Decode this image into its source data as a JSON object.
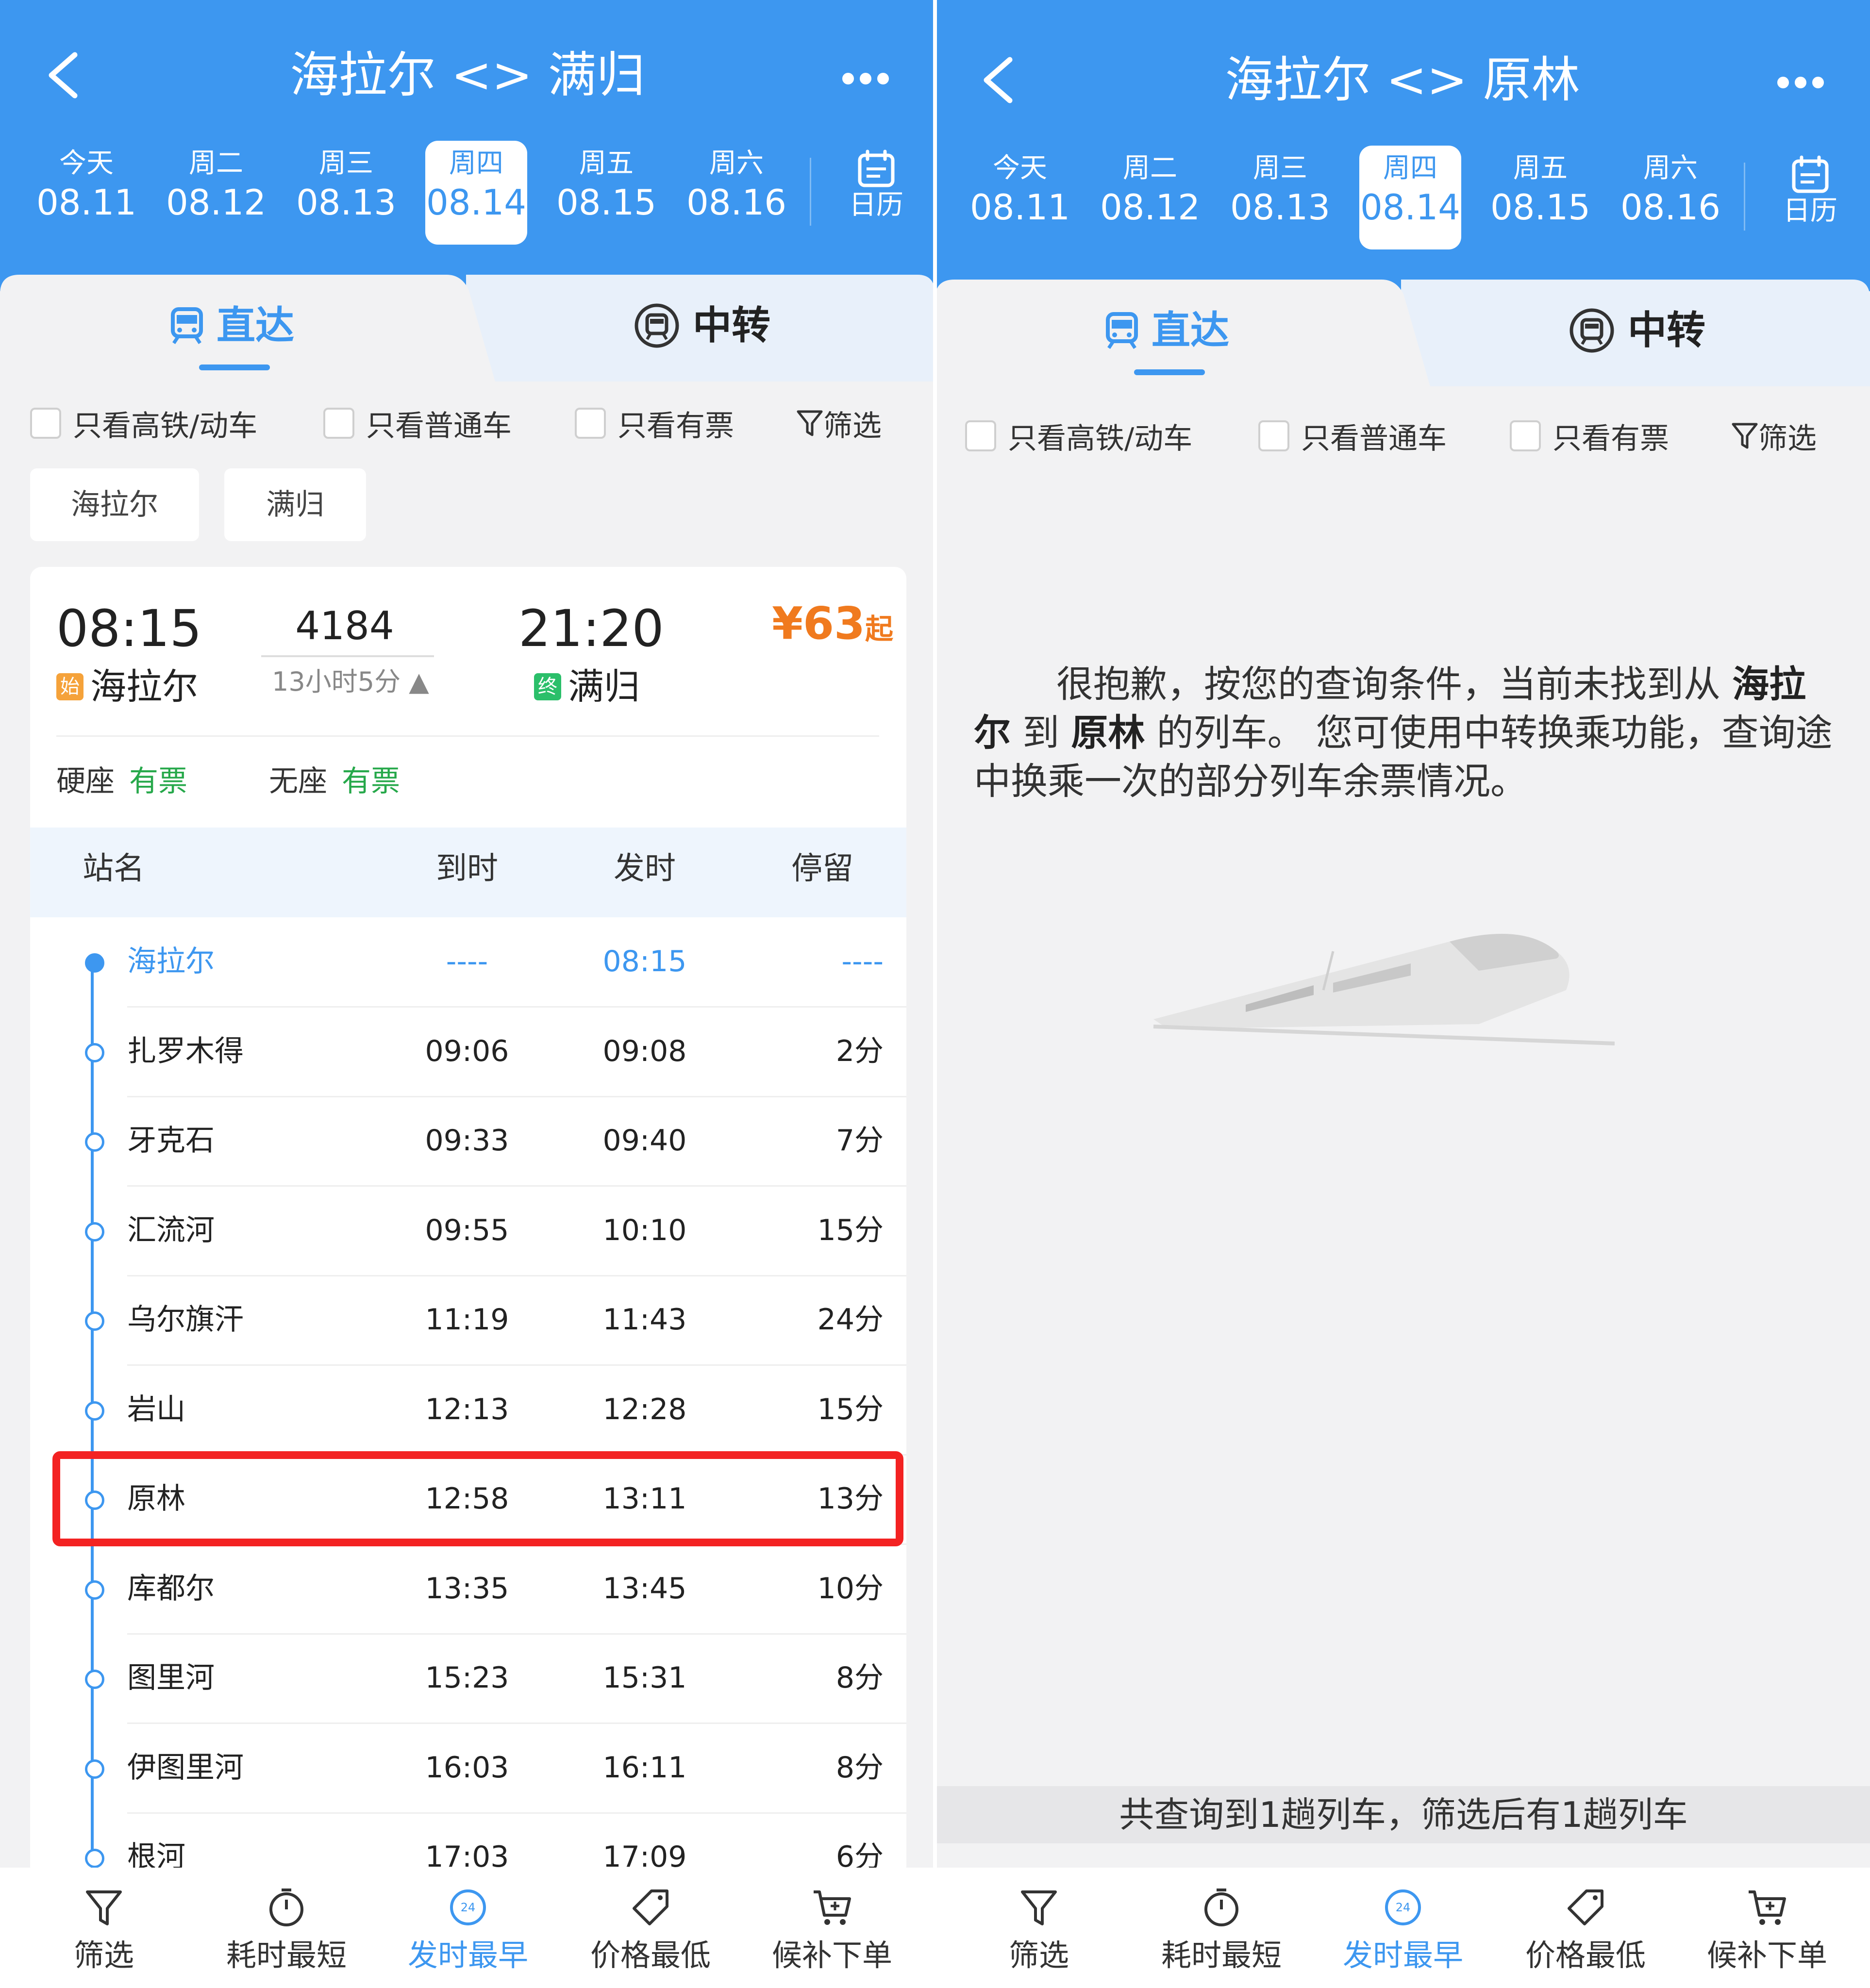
{
  "left": {
    "title": "海拉尔 <> 满归",
    "dates": [
      {
        "week": "今天",
        "date": "08.11",
        "selected": false
      },
      {
        "week": "周二",
        "date": "08.12",
        "selected": false
      },
      {
        "week": "周三",
        "date": "08.13",
        "selected": false
      },
      {
        "week": "周四",
        "date": "08.14",
        "selected": true
      },
      {
        "week": "周五",
        "date": "08.15",
        "selected": false
      },
      {
        "week": "周六",
        "date": "08.16",
        "selected": false
      }
    ],
    "calendar_label": "日历",
    "tabs": {
      "direct": "直达",
      "transfer": "中转"
    },
    "filters": {
      "high_speed": "只看高铁/动车",
      "normal": "只看普通车",
      "available": "只看有票",
      "filter": "筛选"
    },
    "chips": [
      "海拉尔",
      "满归"
    ],
    "train": {
      "dep_time": "08:15",
      "arr_time": "21:20",
      "number": "4184",
      "duration": "13小时5分",
      "dep_tag": "始",
      "arr_tag": "终",
      "dep_station": "海拉尔",
      "arr_station": "满归",
      "price": "¥63",
      "price_suffix": "起",
      "seats": [
        {
          "type": "硬座",
          "status": "有票"
        },
        {
          "type": "无座",
          "status": "有票"
        }
      ]
    },
    "table_headers": {
      "station": "站名",
      "arrive": "到时",
      "depart": "发时",
      "stop": "停留"
    },
    "stops": [
      {
        "name": "海拉尔",
        "arrive": "----",
        "depart": "08:15",
        "stop": "----"
      },
      {
        "name": "扎罗木得",
        "arrive": "09:06",
        "depart": "09:08",
        "stop": "2分"
      },
      {
        "name": "牙克石",
        "arrive": "09:33",
        "depart": "09:40",
        "stop": "7分"
      },
      {
        "name": "汇流河",
        "arrive": "09:55",
        "depart": "10:10",
        "stop": "15分"
      },
      {
        "name": "乌尔旗汗",
        "arrive": "11:19",
        "depart": "11:43",
        "stop": "24分"
      },
      {
        "name": "岩山",
        "arrive": "12:13",
        "depart": "12:28",
        "stop": "15分"
      },
      {
        "name": "原林",
        "arrive": "12:58",
        "depart": "13:11",
        "stop": "13分"
      },
      {
        "name": "库都尔",
        "arrive": "13:35",
        "depart": "13:45",
        "stop": "10分"
      },
      {
        "name": "图里河",
        "arrive": "15:23",
        "depart": "15:31",
        "stop": "8分"
      },
      {
        "name": "伊图里河",
        "arrive": "16:03",
        "depart": "16:11",
        "stop": "8分"
      },
      {
        "name": "根河",
        "arrive": "17:03",
        "depart": "17:09",
        "stop": "6分"
      }
    ]
  },
  "right": {
    "title": "海拉尔 <> 原林",
    "message_pre": "很抱歉，按您的查询条件，当前未找到从 ",
    "message_from": "海拉尔",
    "message_mid": " 到 ",
    "message_to": "原林",
    "message_post": " 的列车。 您可使用中转换乘功能，查询途中换乘一次的部分列车余票情况。",
    "summary": "共查询到1趟列车，筛选后有1趟列车"
  },
  "nav": [
    "筛选",
    "耗时最短",
    "发时最早",
    "价格最低",
    "候补下单"
  ],
  "nav_badge": "24",
  "colors": {
    "primary": "#3d97f0",
    "price": "#f07a1e",
    "available": "#26a84a",
    "highlight": "#f32222"
  }
}
